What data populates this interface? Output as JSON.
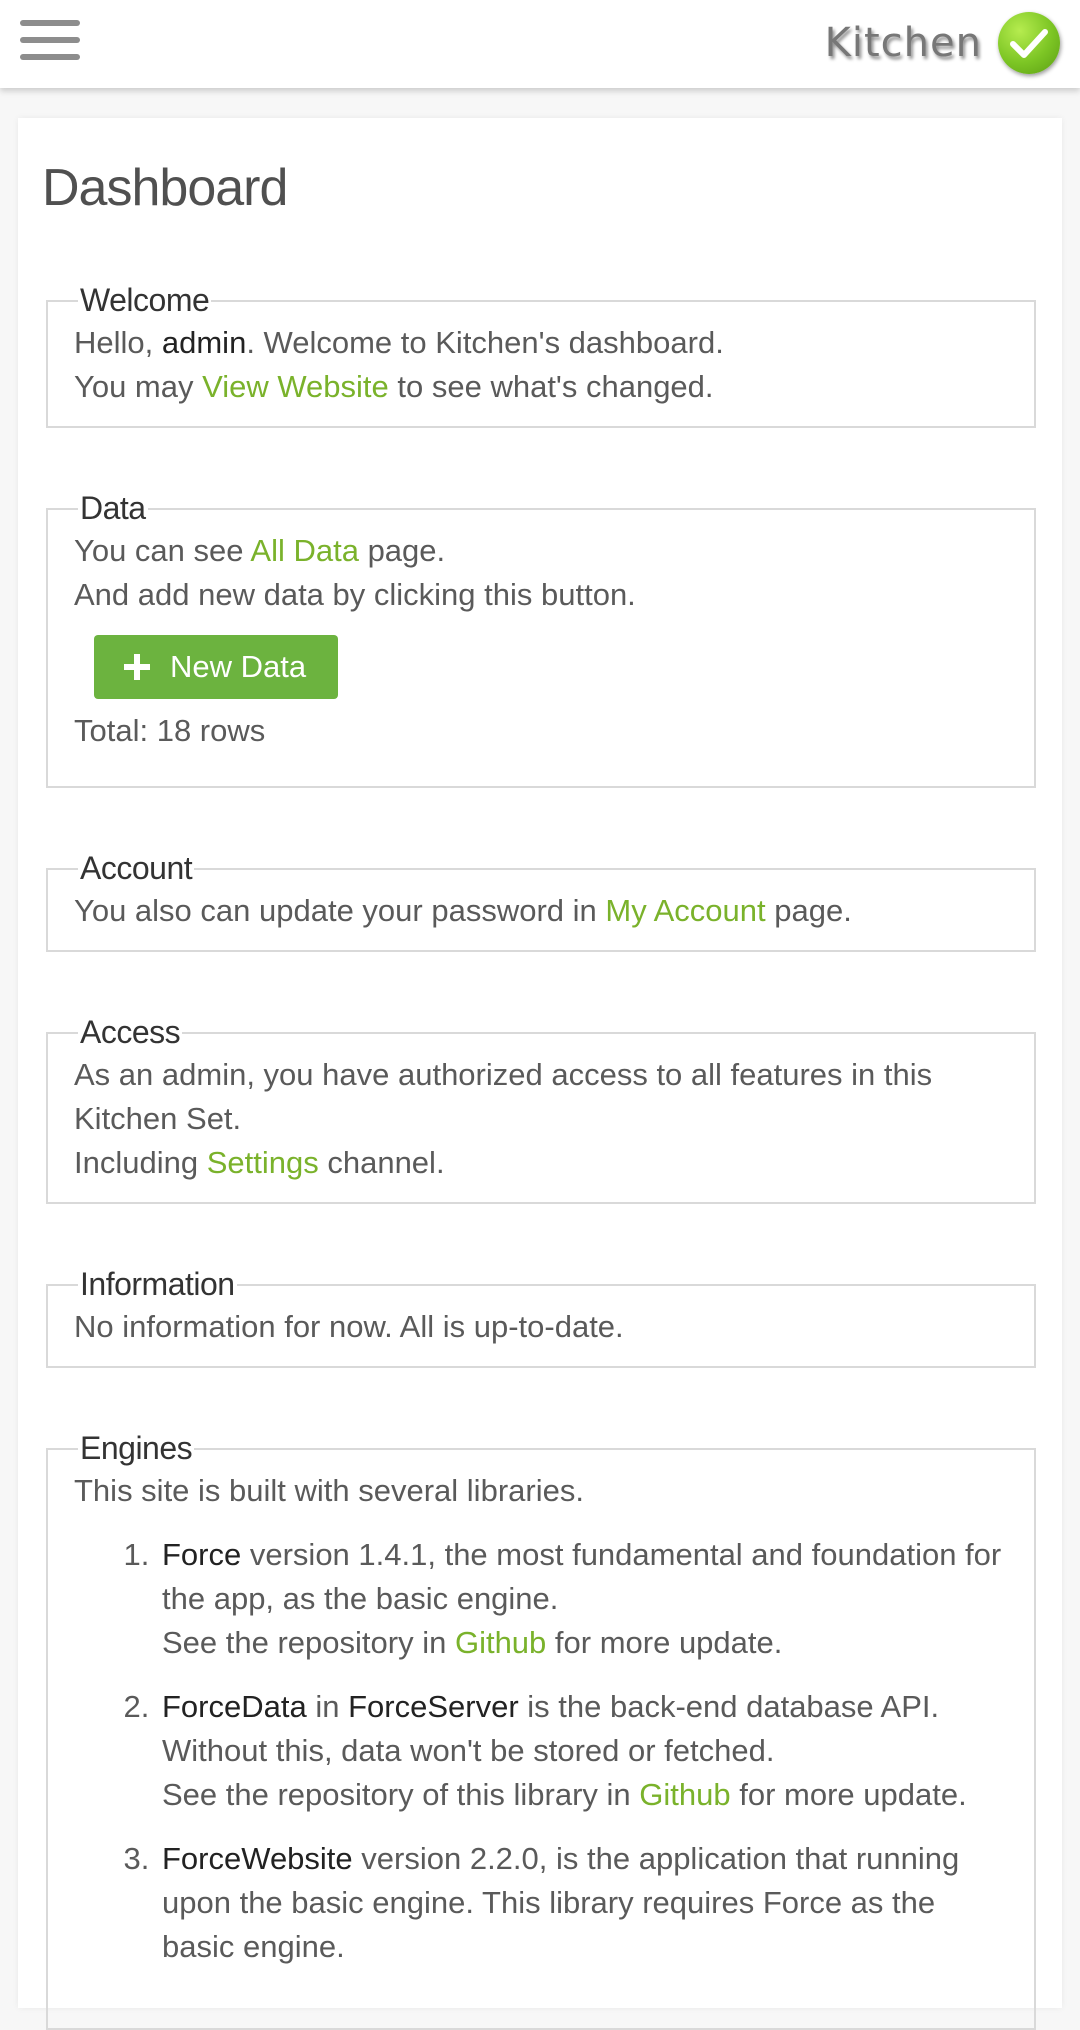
{
  "header": {
    "brand": "Kitchen",
    "colors": {
      "accent": "#7ab22b",
      "button": "#6cb33f",
      "logo": "#7cc524"
    }
  },
  "page": {
    "title": "Dashboard"
  },
  "welcome": {
    "legend": "Welcome",
    "hello": "Hello, ",
    "username": "admin",
    "welcome_text": ". Welcome to Kitchen's dashboard.",
    "line2_pre": "You may ",
    "view_website": "View Website",
    "line2_post": " to see what's changed."
  },
  "data": {
    "legend": "Data",
    "line1_pre": "You can see ",
    "all_data": "All Data",
    "line1_post": " page.",
    "line2": "And add new data by clicking this button.",
    "new_button": "New Data",
    "total": "Total: 18 rows"
  },
  "account": {
    "legend": "Account",
    "pre": "You also can update your password in ",
    "link": "My Account",
    "post": " page."
  },
  "access": {
    "legend": "Access",
    "line1": "As an admin, you have authorized access to all features in this Kitchen Set.",
    "line2_pre": "Including ",
    "settings": "Settings",
    "line2_post": " channel."
  },
  "information": {
    "legend": "Information",
    "text": "No information for now. All is up-to-date."
  },
  "engines": {
    "legend": "Engines",
    "intro": "This site is built with several libraries.",
    "items": [
      {
        "name": "Force",
        "desc": " version 1.4.1, the most fundamental and foundation for the app, as the basic engine.",
        "repo_pre": "See the repository in ",
        "repo_link": "Github",
        "repo_post": " for more update."
      },
      {
        "name": "ForceData",
        "in": " in ",
        "server": "ForceServer",
        "desc": " is the back-end database API.",
        "line2": "Without this, data won't be stored or fetched.",
        "repo_pre": "See the repository of this library in ",
        "repo_link": "Github",
        "repo_post": " for more update."
      },
      {
        "name": "ForceWebsite",
        "desc": " version 2.2.0, is the application that running upon the basic engine. This library requires Force as the basic engine."
      }
    ]
  }
}
